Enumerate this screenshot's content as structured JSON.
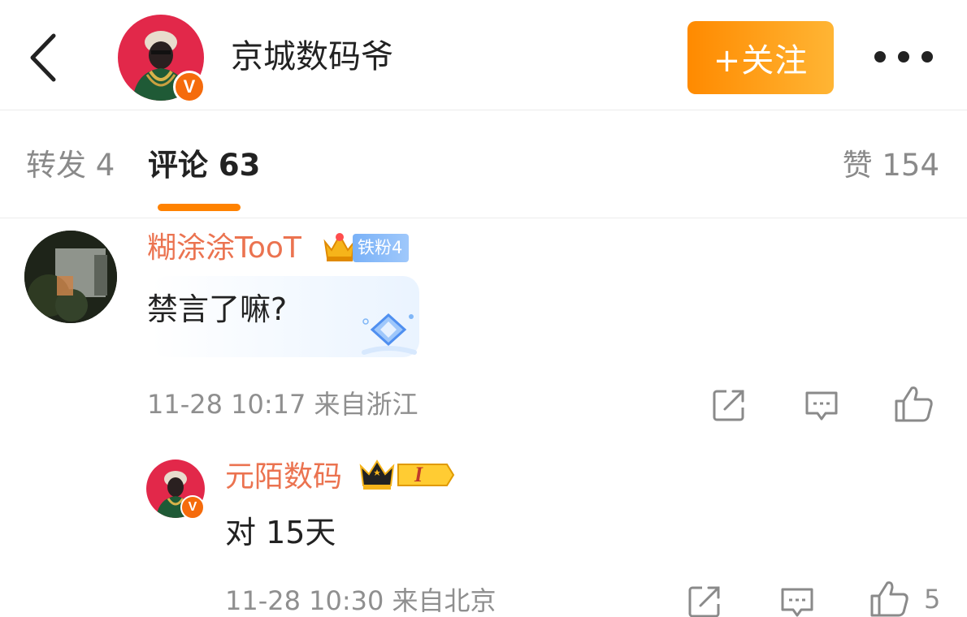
{
  "header": {
    "title": "京城数码爷",
    "follow_label": "+关注",
    "verified_mark": "V"
  },
  "tabs": {
    "repost": "转发 4",
    "comments": "评论 63",
    "likes": "赞 154"
  },
  "comments": [
    {
      "username": "糊涂涂TooT",
      "fan_badge": "铁粉4",
      "text": "禁言了嘛?",
      "meta": "11-28 10:17  来自浙江"
    },
    {
      "username": "元陌数码",
      "level_badge": "I",
      "verified_mark": "V",
      "text": "对  15天",
      "meta": "11-28 10:30  来自北京",
      "like_count": "5"
    }
  ],
  "colors": {
    "accent_orange": "#ff8200",
    "username_color": "#eb7350",
    "muted_text": "#8f8f8f"
  },
  "icons": [
    "back-icon",
    "more-icon",
    "share-icon",
    "reply-icon",
    "like-icon",
    "crown-icon",
    "diamond-icon"
  ]
}
